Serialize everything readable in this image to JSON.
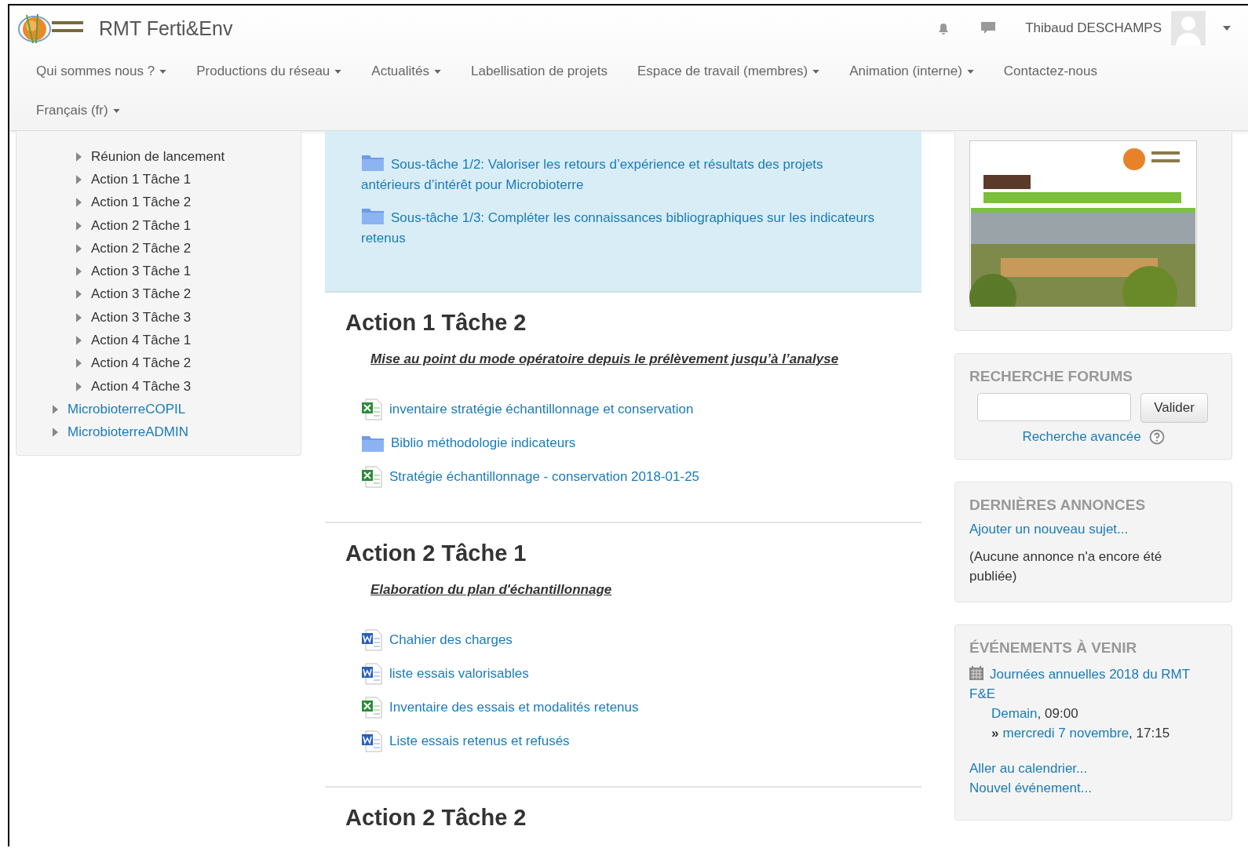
{
  "header": {
    "site_name": "RMT Ferti&Env",
    "user_name": "Thibaud DESCHAMPS",
    "nav": [
      {
        "label": "Qui sommes nous ?",
        "dropdown": true
      },
      {
        "label": "Productions du réseau",
        "dropdown": true
      },
      {
        "label": "Actualités",
        "dropdown": true
      },
      {
        "label": "Labellisation de projets",
        "dropdown": false
      },
      {
        "label": "Espace de travail (membres)",
        "dropdown": true
      },
      {
        "label": "Animation (interne)",
        "dropdown": true
      },
      {
        "label": "Contactez-nous",
        "dropdown": false
      }
    ],
    "language": {
      "label": "Français (fr)",
      "dropdown": true
    }
  },
  "sidebar": {
    "section_items": [
      "Réunion de lancement",
      "Action 1 Tâche 1",
      "Action 1 Tâche 2",
      "Action 2 Tâche 1",
      "Action 2 Tâche 2",
      "Action 3 Tâche 1",
      "Action 3 Tâche 2",
      "Action 3 Tâche 3",
      "Action 4 Tâche 1",
      "Action 4 Tâche 2",
      "Action 4 Tâche 3"
    ],
    "course_items": [
      "MicrobioterreCOPIL",
      "MicrobioterreADMIN"
    ]
  },
  "highlighted_section": {
    "activities": [
      {
        "kind": "folder",
        "text": "Sous-tâche 1/2: Valoriser les retours d’expérience et résultats des projets antérieurs d’intérêt pour Microbioterre"
      },
      {
        "kind": "folder",
        "text": "Sous-tâche 1/3: Compléter les connaissances bibliographiques sur les indicateurs retenus"
      }
    ]
  },
  "sections": [
    {
      "title": "Action 1 Tâche 2",
      "summary": "Mise au point du mode opératoire depuis le prélèvement jusqu’à l’analyse",
      "activities": [
        {
          "kind": "spreadsheet",
          "text": "inventaire stratégie échantillonnage et conservation"
        },
        {
          "kind": "folder",
          "text": "Biblio méthodologie indicateurs"
        },
        {
          "kind": "spreadsheet",
          "text": "Stratégie échantillonnage - conservation 2018-01-25"
        }
      ]
    },
    {
      "title": "Action 2 Tâche 1",
      "summary": "Elaboration du plan d'échantillonnage",
      "activities": [
        {
          "kind": "document",
          "text": "Chahier des charges"
        },
        {
          "kind": "document",
          "text": "liste essais valorisables"
        },
        {
          "kind": "spreadsheet",
          "text": "Inventaire des essais et modalités retenus"
        },
        {
          "kind": "document",
          "text": "Liste essais retenus et refusés"
        }
      ]
    },
    {
      "title": "Action 2 Tâche 2"
    }
  ],
  "blocks": {
    "forum_search": {
      "title": "RECHERCHE FORUMS",
      "button": "Valider",
      "link": "Recherche avancée"
    },
    "announcements": {
      "title": "DERNIÈRES ANNONCES",
      "link": "Ajouter un nouveau sujet...",
      "text": "(Aucune annonce n'a encore été publiée)"
    },
    "events": {
      "title": "ÉVÉNEMENTS À VENIR",
      "event": {
        "name": "Journées annuelles 2018 du RMT F&E",
        "start_date": "Demain",
        "start_time": ", 09:00",
        "arrow": "»",
        "end_date": "mercredi 7 novembre",
        "end_time": ", 17:15"
      },
      "links": [
        "Aller au calendrier...",
        "Nouvel événement..."
      ]
    }
  }
}
